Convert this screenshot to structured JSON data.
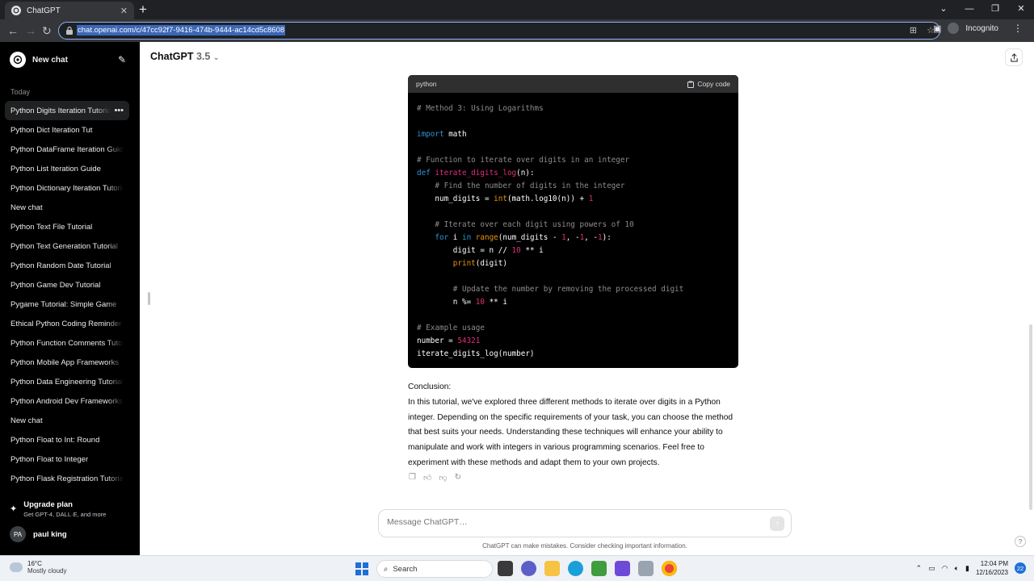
{
  "browser": {
    "tab_title": "ChatGPT",
    "url": "chat.openai.com/c/47cc92f7-9416-474b-9444-ac14cd5c8608",
    "profile_label": "Incognito"
  },
  "sidebar": {
    "new_chat_label": "New chat",
    "section_label": "Today",
    "items": [
      {
        "label": "Python Digits Iteration Tutorial"
      },
      {
        "label": "Python Dict Iteration Tut"
      },
      {
        "label": "Python DataFrame Iteration Guide"
      },
      {
        "label": "Python List Iteration Guide"
      },
      {
        "label": "Python Dictionary Iteration Tutorial"
      },
      {
        "label": "New chat"
      },
      {
        "label": "Python Text File Tutorial"
      },
      {
        "label": "Python Text Generation Tutorial"
      },
      {
        "label": "Python Random Date Tutorial"
      },
      {
        "label": "Python Game Dev Tutorial"
      },
      {
        "label": "Pygame Tutorial: Simple Game"
      },
      {
        "label": "Ethical Python Coding Reminder"
      },
      {
        "label": "Python Function Comments Tutorial"
      },
      {
        "label": "Python Mobile App Frameworks"
      },
      {
        "label": "Python Data Engineering Tutorial"
      },
      {
        "label": "Python Android Dev Frameworks"
      },
      {
        "label": "New chat"
      },
      {
        "label": "Python Float to Int: Round"
      },
      {
        "label": "Python Float to Integer"
      },
      {
        "label": "Python Flask Registration Tutorial"
      }
    ],
    "upgrade_title": "Upgrade plan",
    "upgrade_sub": "Get GPT-4, DALL·E, and more",
    "user_initials": "PA",
    "user_name": "paul king"
  },
  "header": {
    "model_name": "ChatGPT",
    "model_version": "3.5"
  },
  "code": {
    "language": "python",
    "copy_label": "Copy code"
  },
  "conclusion": {
    "heading": "Conclusion:",
    "body": "In this tutorial, we've explored three different methods to iterate over digits in a Python integer. Depending on the specific requirements of your task, you can choose the method that best suits your needs. Understanding these techniques will enhance your ability to manipulate and work with integers in various programming scenarios. Feel free to experiment with these methods and adapt them to your own projects."
  },
  "composer": {
    "placeholder": "Message ChatGPT…"
  },
  "disclaimer": "ChatGPT can make mistakes. Consider checking important information.",
  "help": "?",
  "taskbar": {
    "temp": "16°C",
    "weather": "Mostly cloudy",
    "search_label": "Search",
    "time": "12:04 PM",
    "date": "12/16/2023",
    "notif_count": "22"
  }
}
